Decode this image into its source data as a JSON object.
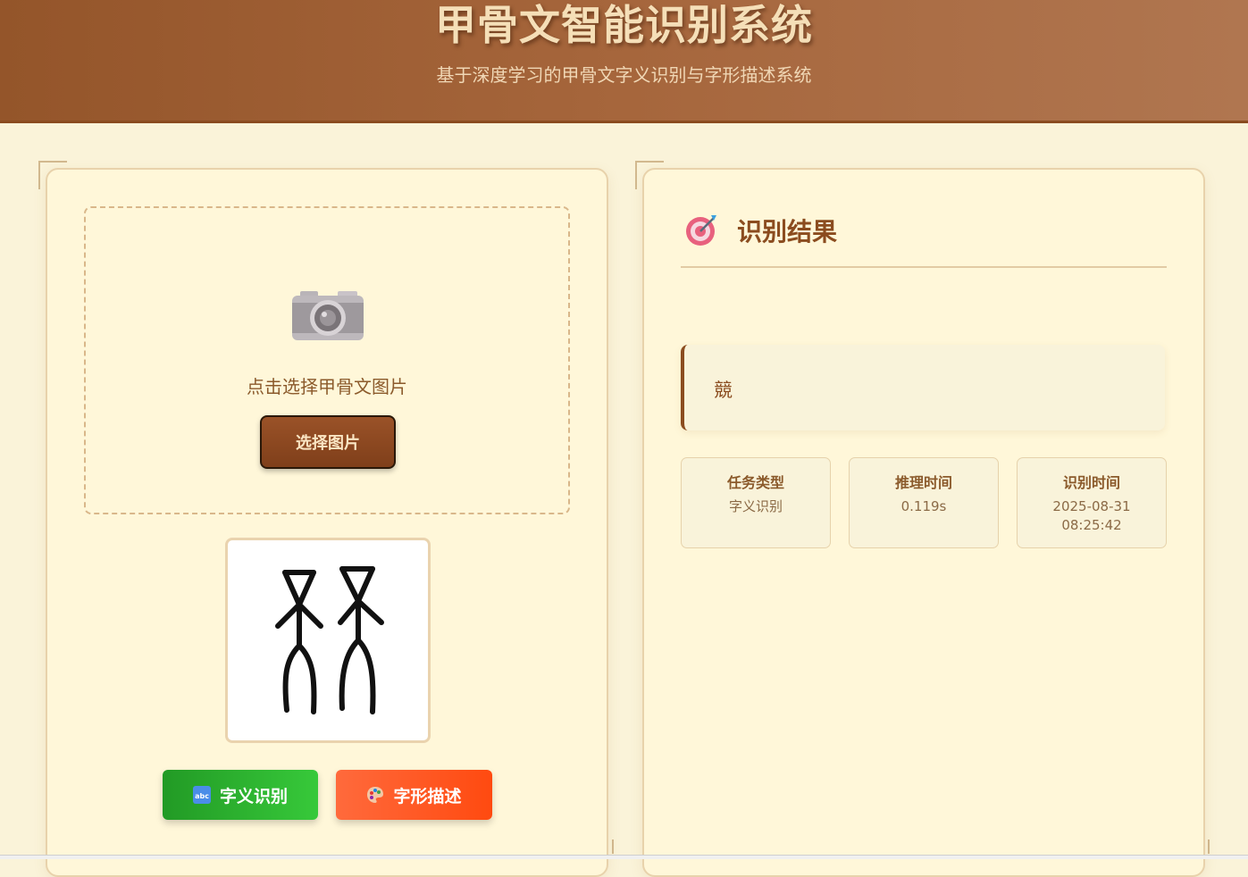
{
  "header": {
    "title": "甲骨文智能识别系统",
    "subtitle": "基于深度学习的甲骨文字义识别与字形描述系统"
  },
  "upload": {
    "icon": "camera-icon",
    "hint": "点击选择甲骨文图片",
    "choose_label": "选择图片"
  },
  "preview": {
    "alt": "oracle-bone-glyph-image"
  },
  "actions": {
    "meaning": {
      "icon": "abc-icon",
      "label": "字义识别",
      "color": "#2ea82f"
    },
    "shape": {
      "icon": "palette-icon",
      "label": "字形描述",
      "color": "#ff5722"
    }
  },
  "result": {
    "icon": "target-icon",
    "title": "识别结果",
    "text": "競",
    "cards": [
      {
        "label": "任务类型",
        "value": "字义识别"
      },
      {
        "label": "推理时间",
        "value": "0.119s"
      },
      {
        "label": "识别时间",
        "value": "2025-08-31 08:25:42"
      }
    ]
  },
  "colors": {
    "header": "#a6663c",
    "background": "#faf3d9",
    "accent": "#8b4c1f"
  }
}
